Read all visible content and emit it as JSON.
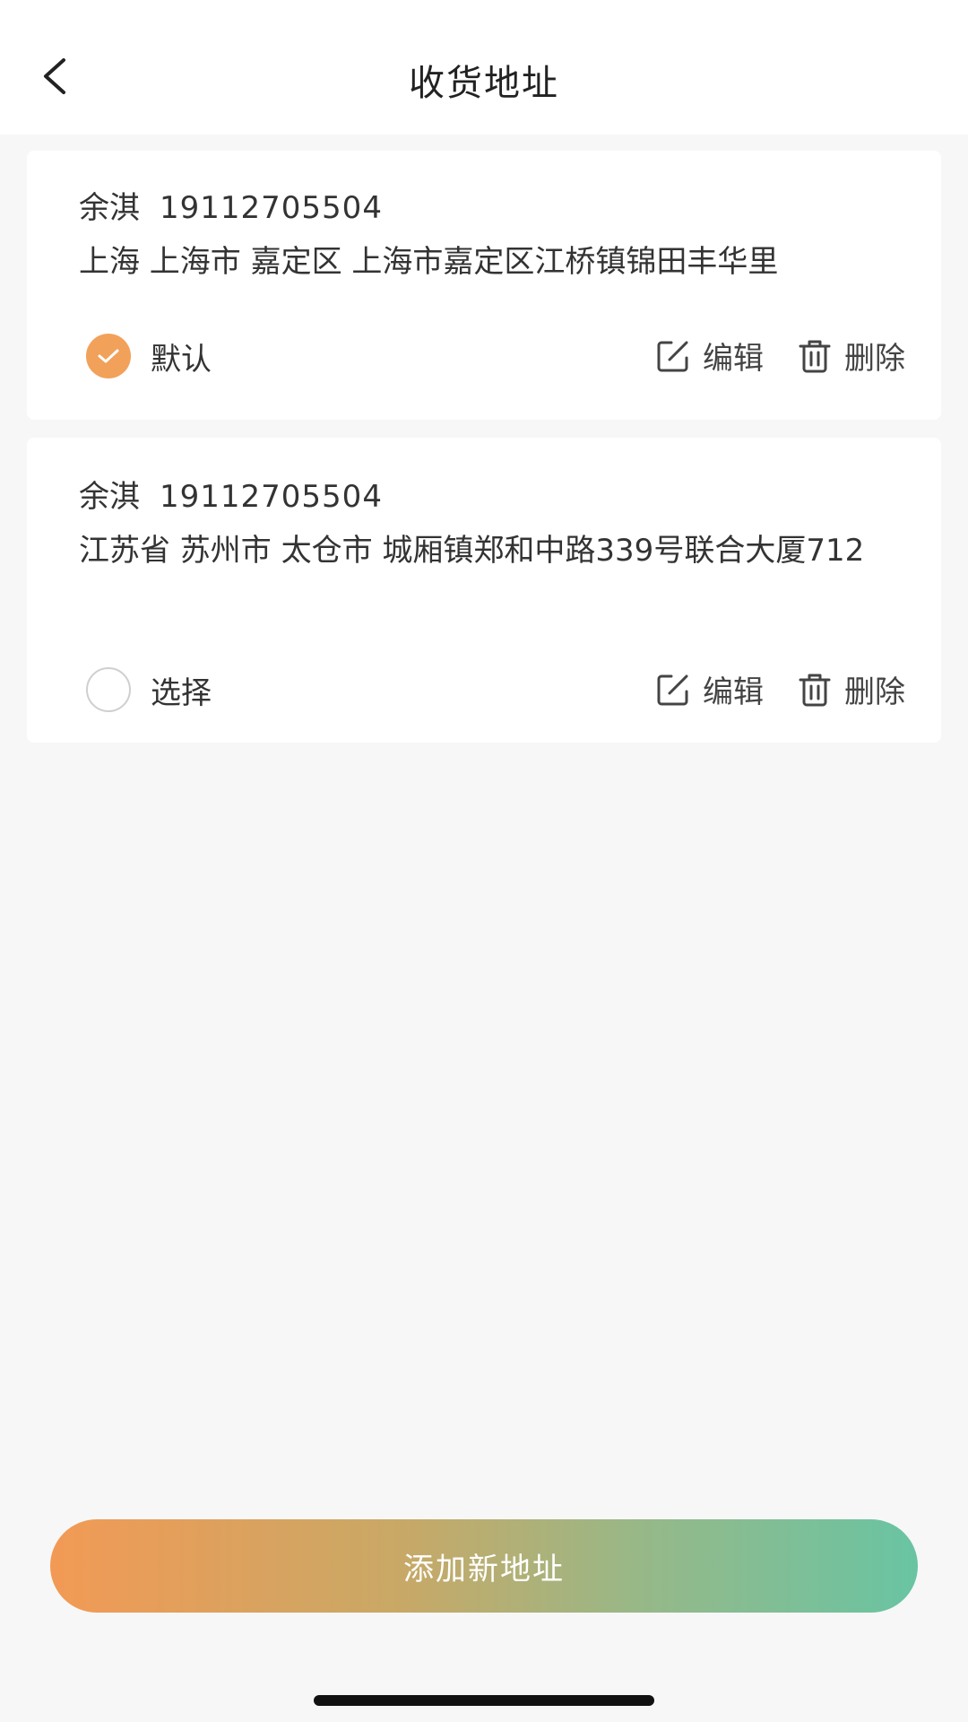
{
  "header": {
    "title": "收货地址",
    "back_icon": "chevron-left-icon"
  },
  "addresses": [
    {
      "name": "余淇",
      "phone": "19112705504",
      "address": "上海 上海市 嘉定区 上海市嘉定区江桥镇锦田丰华里",
      "select_label": "默认",
      "selected": true,
      "edit_label": "编辑",
      "delete_label": "删除"
    },
    {
      "name": "余淇",
      "phone": "19112705504",
      "address": "江苏省 苏州市 太仓市 城厢镇郑和中路339号联合大厦712",
      "select_label": "选择",
      "selected": false,
      "edit_label": "编辑",
      "delete_label": "删除"
    }
  ],
  "add_button": {
    "label": "添加新地址"
  },
  "colors": {
    "accent": "#f2a15a",
    "gradient_start": "#f29a55",
    "gradient_end": "#69c4a3"
  }
}
